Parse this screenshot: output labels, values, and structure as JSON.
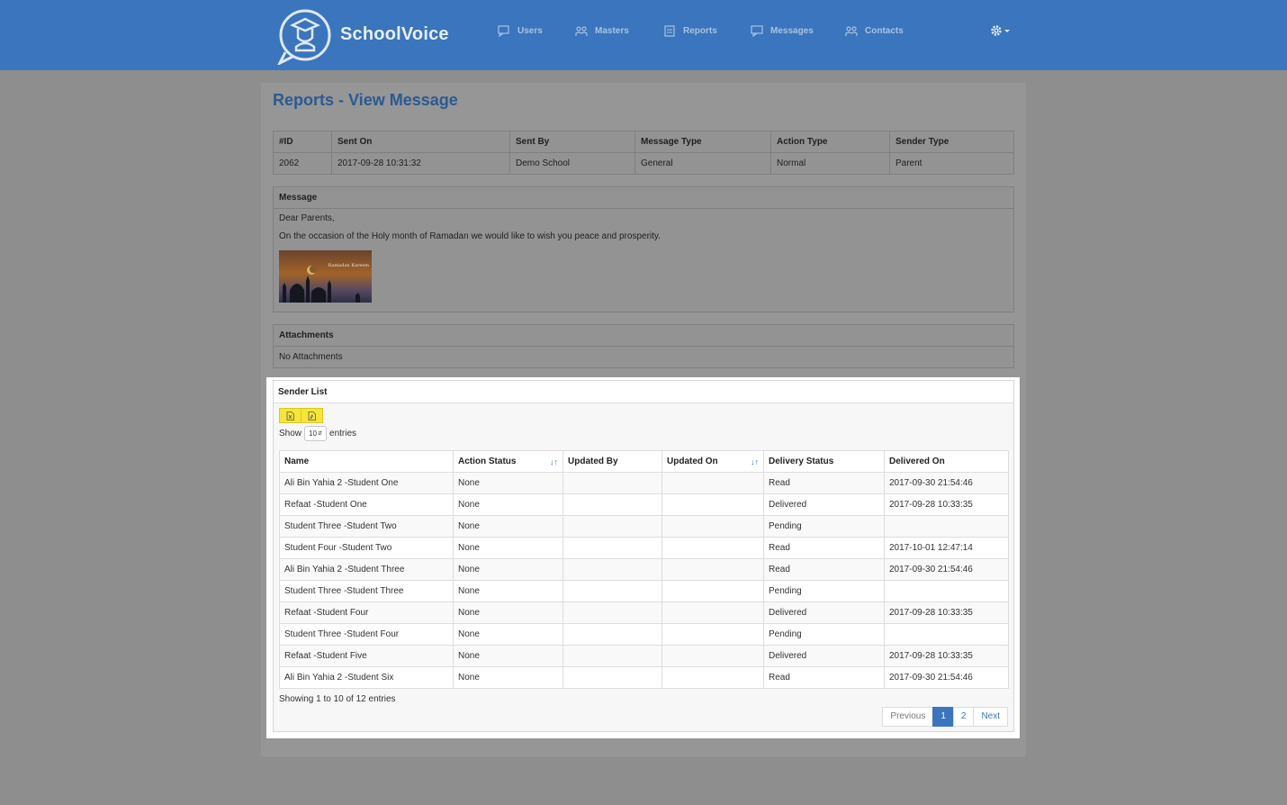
{
  "brand": {
    "name": "SchoolVoice"
  },
  "nav": [
    {
      "label": "Users",
      "icon": "users-icon"
    },
    {
      "label": "Masters",
      "icon": "masters-icon"
    },
    {
      "label": "Reports",
      "icon": "reports-icon"
    },
    {
      "label": "Messages",
      "icon": "messages-icon"
    },
    {
      "label": "Contacts",
      "icon": "contacts-icon"
    }
  ],
  "page": {
    "title": "Reports - View Message"
  },
  "info_table": {
    "headers": [
      "#ID",
      "Sent On",
      "Sent By",
      "Message Type",
      "Action Type",
      "Sender Type"
    ],
    "row": [
      "2062",
      "2017-09-28 10:31:32",
      "Demo School",
      "General",
      "Normal",
      "Parent"
    ]
  },
  "message": {
    "title": "Message",
    "lines": [
      "Dear Parents,",
      "On the occasion of the Holy month of Ramadan we would like to wish you peace and prosperity."
    ],
    "image_caption": "Ramadan Kareem"
  },
  "attachments": {
    "title": "Attachments",
    "text": "No Attachments"
  },
  "sender_list": {
    "title": "Sender List",
    "show_prefix": "Show",
    "show_value": "10",
    "show_suffix": "entries",
    "headers": [
      "Name",
      "Action Status",
      "Updated By",
      "Updated On",
      "Delivery Status",
      "Delivered On"
    ],
    "rows": [
      [
        "Ali Bin Yahia 2 -Student One",
        "None",
        "",
        "",
        "Read",
        "2017-09-30 21:54:46"
      ],
      [
        "Refaat -Student One",
        "None",
        "",
        "",
        "Delivered",
        "2017-09-28 10:33:35"
      ],
      [
        "Student Three -Student Two",
        "None",
        "",
        "",
        "Pending",
        ""
      ],
      [
        "Student Four -Student Two",
        "None",
        "",
        "",
        "Read",
        "2017-10-01 12:47:14"
      ],
      [
        "Ali Bin Yahia 2 -Student Three",
        "None",
        "",
        "",
        "Read",
        "2017-09-30 21:54:46"
      ],
      [
        "Student Three -Student Three",
        "None",
        "",
        "",
        "Pending",
        ""
      ],
      [
        "Refaat -Student Four",
        "None",
        "",
        "",
        "Delivered",
        "2017-09-28 10:33:35"
      ],
      [
        "Student Three -Student Four",
        "None",
        "",
        "",
        "Pending",
        ""
      ],
      [
        "Refaat -Student Five",
        "None",
        "",
        "",
        "Delivered",
        "2017-09-28 10:33:35"
      ],
      [
        "Ali Bin Yahia 2 -Student Six",
        "None",
        "",
        "",
        "Read",
        "2017-09-30 21:54:46"
      ]
    ],
    "showing": "Showing 1 to 10 of 12 entries",
    "pagination": {
      "previous": "Previous",
      "pages": [
        "1",
        "2"
      ],
      "active": "1",
      "next": "Next"
    }
  },
  "colors": {
    "header": "#3a75bd",
    "accent": "#3a75bd",
    "export": "#f6e63a"
  }
}
